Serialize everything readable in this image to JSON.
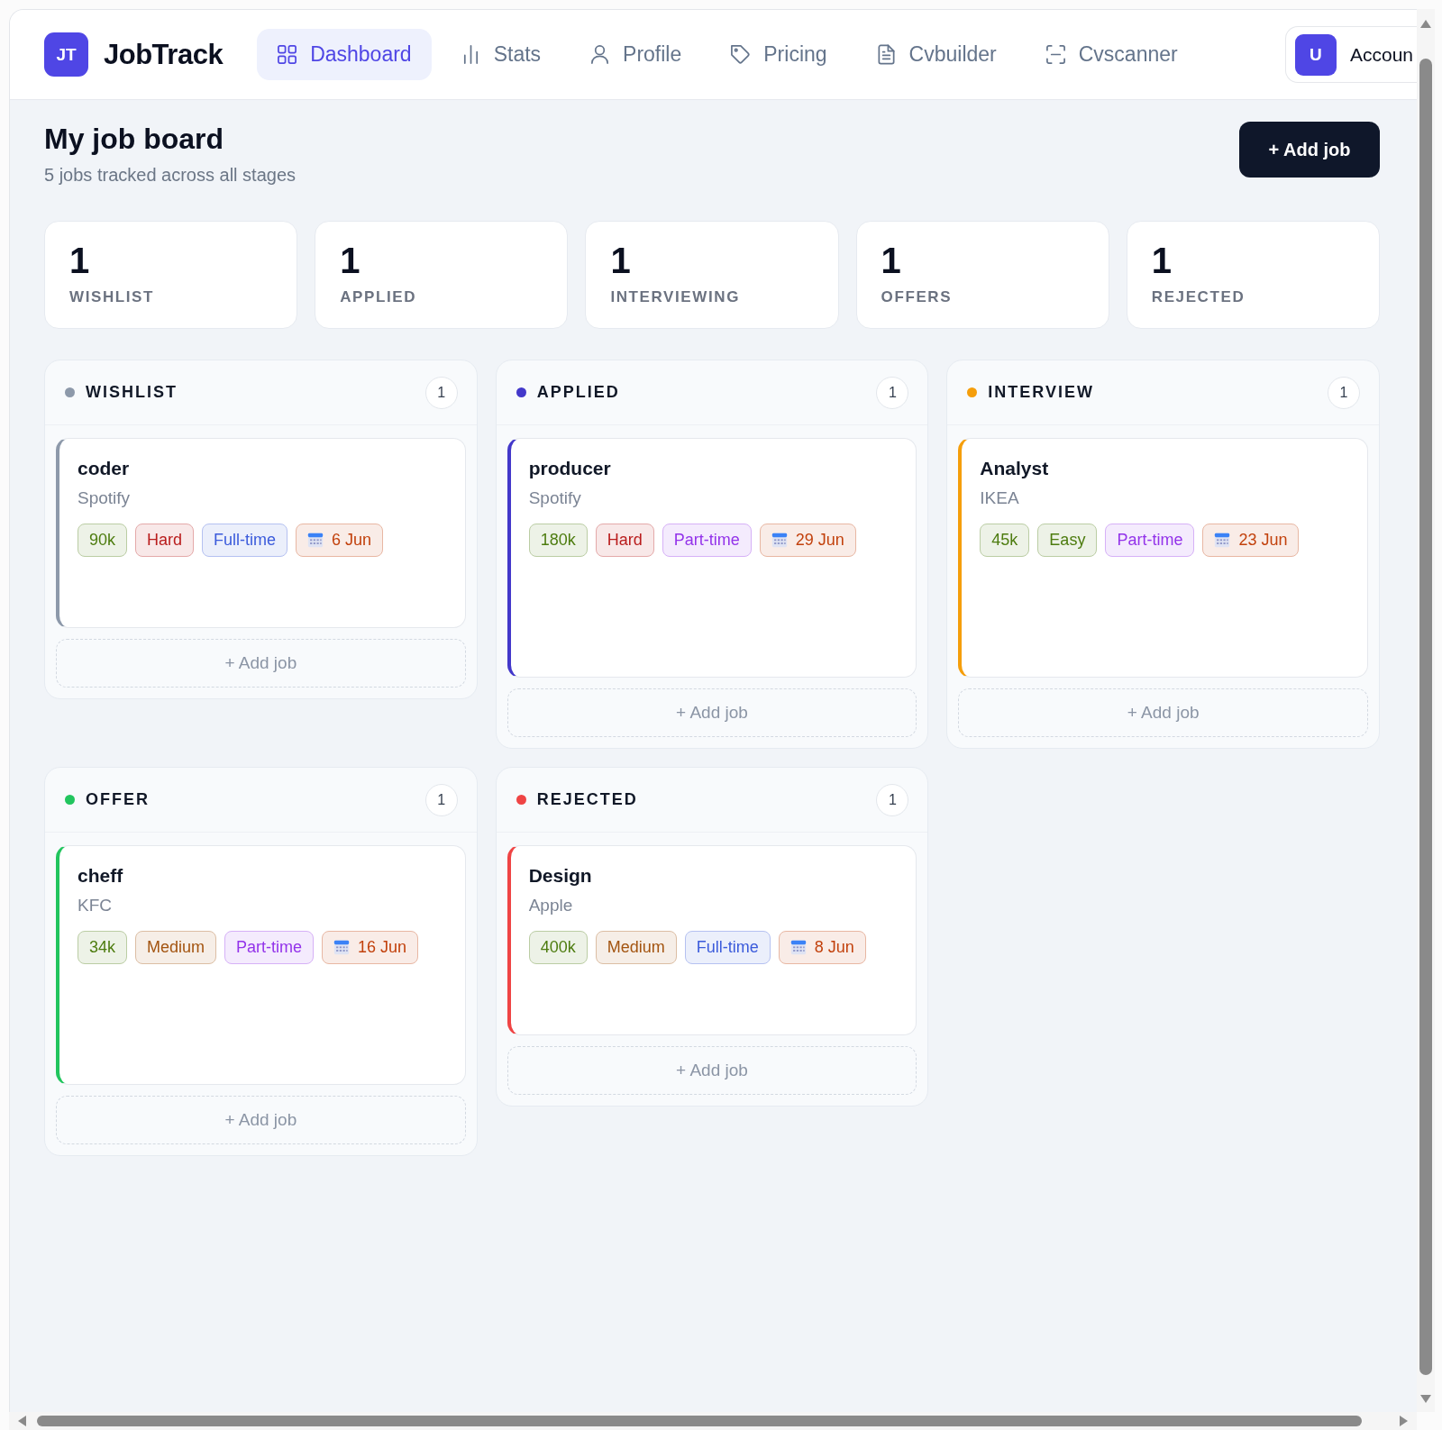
{
  "brand": {
    "logo": "JT",
    "name": "JobTrack"
  },
  "nav": [
    {
      "label": "Dashboard",
      "selected": true
    },
    {
      "label": "Stats",
      "selected": false
    },
    {
      "label": "Profile",
      "selected": false
    },
    {
      "label": "Pricing",
      "selected": false
    },
    {
      "label": "Cvbuilder",
      "selected": false
    },
    {
      "label": "Cvscanner",
      "selected": false
    }
  ],
  "account": {
    "avatar": "U",
    "label": "Accoun"
  },
  "header": {
    "title": "My job board",
    "subtitle": "5 jobs tracked across all stages",
    "add_button": "+ Add job"
  },
  "stats": [
    {
      "value": "1",
      "label": "WISHLIST"
    },
    {
      "value": "1",
      "label": "APPLIED"
    },
    {
      "value": "1",
      "label": "INTERVIEWING"
    },
    {
      "value": "1",
      "label": "OFFERS"
    },
    {
      "value": "1",
      "label": "REJECTED"
    }
  ],
  "columns": [
    {
      "title": "WISHLIST",
      "color": "#8d99aa",
      "count": "1",
      "jobs": [
        {
          "title": "coder",
          "company": "Spotify",
          "tags": [
            {
              "kind": "salary",
              "text": "90k",
              "color": "#4d7c0f"
            },
            {
              "kind": "difficulty",
              "text": "Hard",
              "color": "#b91c1c"
            },
            {
              "kind": "type",
              "text": "Full-time",
              "color": "#3b5bdb"
            },
            {
              "kind": "date",
              "text": "6 Jun",
              "color": "#c2410c"
            }
          ]
        }
      ],
      "add_label": "+ Add job"
    },
    {
      "title": "APPLIED",
      "color": "#4338ca",
      "count": "1",
      "jobs": [
        {
          "title": "producer",
          "company": "Spotify",
          "tags": [
            {
              "kind": "salary",
              "text": "180k",
              "color": "#4d7c0f"
            },
            {
              "kind": "difficulty",
              "text": "Hard",
              "color": "#b91c1c"
            },
            {
              "kind": "type",
              "text": "Part-time",
              "color": "#9333ea"
            },
            {
              "kind": "date",
              "text": "29 Jun",
              "color": "#c2410c"
            }
          ]
        }
      ],
      "add_label": "+ Add job"
    },
    {
      "title": "INTERVIEW",
      "color": "#f59e0b",
      "count": "1",
      "jobs": [
        {
          "title": "Analyst",
          "company": "IKEA",
          "tags": [
            {
              "kind": "salary",
              "text": "45k",
              "color": "#4d7c0f"
            },
            {
              "kind": "difficulty",
              "text": "Easy",
              "color": "#4d7c0f"
            },
            {
              "kind": "type",
              "text": "Part-time",
              "color": "#9333ea"
            },
            {
              "kind": "date",
              "text": "23 Jun",
              "color": "#c2410c"
            }
          ]
        }
      ],
      "add_label": "+ Add job"
    },
    {
      "title": "OFFER",
      "color": "#22c55e",
      "count": "1",
      "jobs": [
        {
          "title": "cheff",
          "company": "KFC",
          "tags": [
            {
              "kind": "salary",
              "text": "34k",
              "color": "#4d7c0f"
            },
            {
              "kind": "difficulty",
              "text": "Medium",
              "color": "#a35410"
            },
            {
              "kind": "type",
              "text": "Part-time",
              "color": "#9333ea"
            },
            {
              "kind": "date",
              "text": "16 Jun",
              "color": "#c2410c"
            }
          ]
        }
      ],
      "add_label": "+ Add job"
    },
    {
      "title": "REJECTED",
      "color": "#ef4444",
      "count": "1",
      "jobs": [
        {
          "title": "Design",
          "company": "Apple",
          "tags": [
            {
              "kind": "salary",
              "text": "400k",
              "color": "#4d7c0f"
            },
            {
              "kind": "difficulty",
              "text": "Medium",
              "color": "#a35410"
            },
            {
              "kind": "type",
              "text": "Full-time",
              "color": "#3b5bdb"
            },
            {
              "kind": "date",
              "text": "8 Jun",
              "color": "#c2410c"
            }
          ]
        }
      ],
      "add_label": "+ Add job"
    }
  ]
}
